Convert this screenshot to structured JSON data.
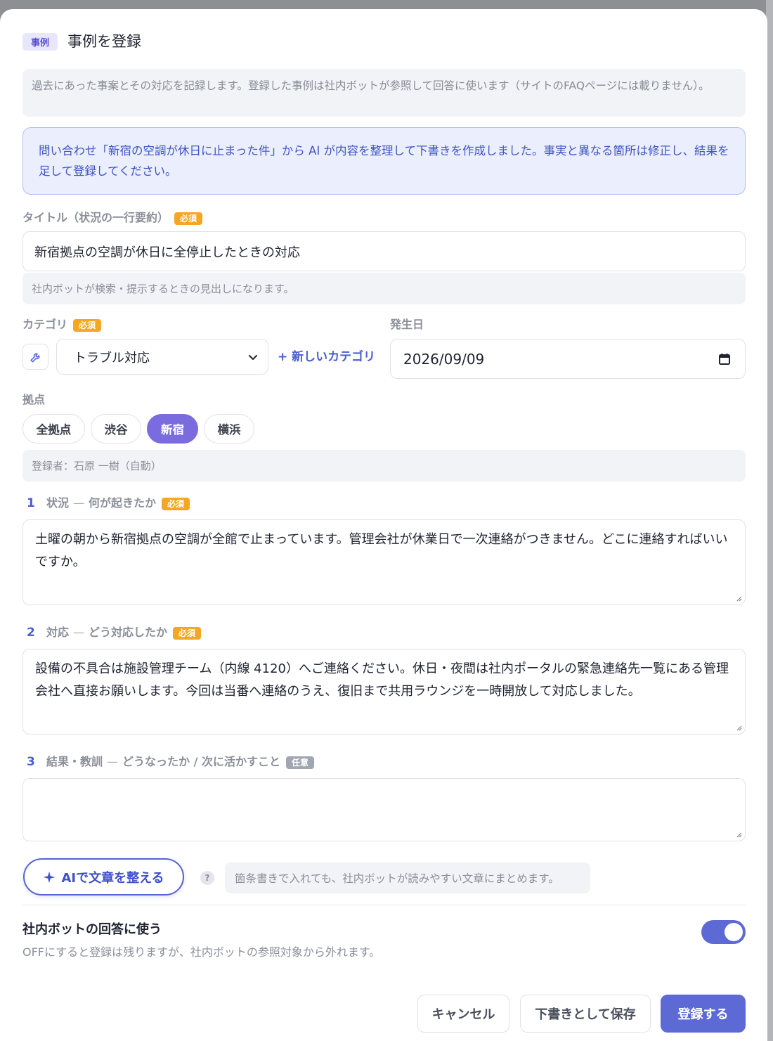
{
  "header": {
    "badge": "事例",
    "title": "事例を登録"
  },
  "intro_note": "過去にあった事案とその対応を記録します。登録した事例は社内ボットが参照して回答に使います（サイトのFAQページには載りません）。",
  "ai_banner": "問い合わせ「新宿の空調が休日に止まった件」から AI が内容を整理して下書きを作成しました。事実と異なる箇所は修正し、結果を足して登録してください。",
  "required_label": "必須",
  "optional_label": "任意",
  "title_field": {
    "label": "タイトル（状況の一行要約）",
    "value": "新宿拠点の空調が休日に全停止したときの対応",
    "hint": "社内ボットが検索・提示するときの見出しになります。"
  },
  "category_field": {
    "label": "カテゴリ",
    "icon": "wrench-icon",
    "selected": "トラブル対応",
    "new_category_label": "+ 新しいカテゴリ"
  },
  "date_field": {
    "label": "発生日",
    "value": "2026/09/09"
  },
  "locations": {
    "label": "拠点",
    "options": [
      "全拠点",
      "渋谷",
      "新宿",
      "横浜"
    ],
    "selected": "新宿"
  },
  "registrant_note": "登録者：石原 一樹（自動）",
  "sections": [
    {
      "num": "1",
      "name": "状況",
      "question": "何が起きたか",
      "badge": "必須",
      "value": "土曜の朝から新宿拠点の空調が全館で止まっています。管理会社が休業日で一次連絡がつきません。どこに連絡すればいいですか。"
    },
    {
      "num": "2",
      "name": "対応",
      "question": "どう対応したか",
      "badge": "必須",
      "value": "設備の不具合は施設管理チーム（内線 4120）へご連絡ください。休日・夜間は社内ポータルの緊急連絡先一覧にある管理会社へ直接お願いします。今回は当番へ連絡のうえ、復旧まで共用ラウンジを一時開放して対応しました。"
    },
    {
      "num": "3",
      "name": "結果・教訓",
      "question": "どうなったか / 次に活かすこと",
      "badge": "任意",
      "value": ""
    }
  ],
  "ai_tidy": {
    "button_label": "AIで文章を整える",
    "help": "?",
    "hint": "箇条書きで入れても、社内ボットが読みやすい文章にまとめます。"
  },
  "bot_toggle": {
    "title": "社内ボットの回答に使う",
    "description": "OFFにすると登録は残りますが、社内ボットの参照対象から外れます。",
    "on": true
  },
  "footer": {
    "cancel": "キャンセル",
    "save_draft": "下書きとして保存",
    "submit": "登録する"
  },
  "colors": {
    "accent": "#5d6ad6",
    "chip_active": "#7a6cde",
    "required_badge": "#f5a623",
    "banner_bg": "#ebeefc",
    "banner_text": "#3f55c4"
  }
}
